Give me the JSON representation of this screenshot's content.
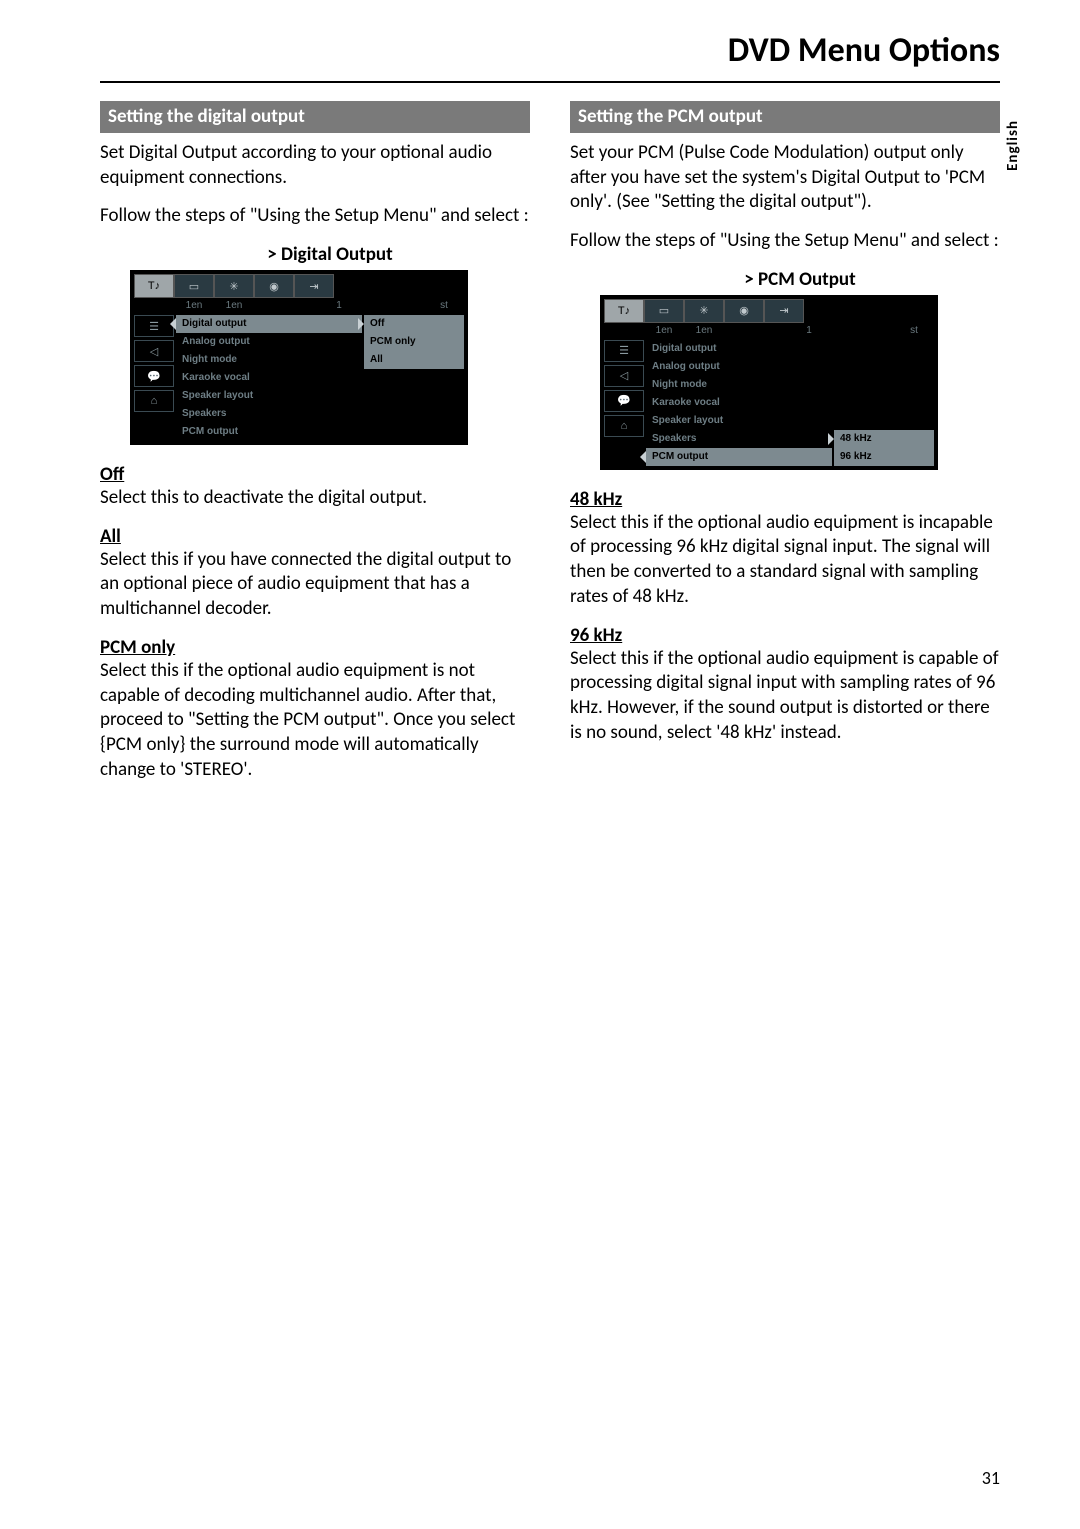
{
  "page_title": "DVD Menu Options",
  "language_tab": "English",
  "page_number": "31",
  "left": {
    "section_bar": "Setting the digital output",
    "intro1": "Set Digital Output according to your optional audio equipment connections.",
    "intro2": "Follow the steps of \"Using the Setup Menu\" and select :",
    "osd_title": ">  Digital Output",
    "osd": {
      "sub": [
        "1en",
        "1en",
        "1",
        "st"
      ],
      "menu": [
        "Digital output",
        "Analog output",
        "Night mode",
        "Karaoke vocal",
        "Speaker layout",
        "Speakers",
        "PCM output"
      ],
      "selected_index": 0,
      "values": [
        "Off",
        "PCM only",
        "All"
      ]
    },
    "options": [
      {
        "head": "Off",
        "desc": "Select this to deactivate the digital output."
      },
      {
        "head": "All",
        "desc": "Select this if you have connected the digital output to an optional piece of audio equipment that has a multichannel decoder."
      },
      {
        "head": "PCM only",
        "desc": "Select this if the optional audio equipment is not capable of decoding multichannel audio.  After that, proceed to \"Setting the PCM output\".  Once you select {PCM only} the surround mode will automatically change to 'STEREO'."
      }
    ]
  },
  "right": {
    "section_bar": "Setting the PCM output",
    "intro1": "Set your PCM (Pulse Code Modulation) output only after you have set the system's Digital Output to 'PCM only'. (See \"Setting the digital output\").",
    "intro2": "Follow the steps of \"Using the Setup Menu\" and select :",
    "osd_title": ">  PCM Output",
    "osd": {
      "sub": [
        "1en",
        "1en",
        "1",
        "st"
      ],
      "menu": [
        "Digital output",
        "Analog output",
        "Night mode",
        "Karaoke vocal",
        "Speaker layout",
        "Speakers",
        "PCM output"
      ],
      "selected_index": 6,
      "values": [
        "48 kHz",
        "96 kHz"
      ]
    },
    "options": [
      {
        "head": "48 kHz",
        "desc": "Select this if the optional audio equipment is incapable of processing 96 kHz digital signal input.  The signal will then be converted to a standard signal with sampling rates of 48 kHz."
      },
      {
        "head": "96 kHz",
        "desc": "Select this if the optional audio equipment is capable of processing digital signal input with sampling rates of 96 kHz. However, if the sound output is distorted or there is no sound, select '48 kHz' instead."
      }
    ]
  }
}
